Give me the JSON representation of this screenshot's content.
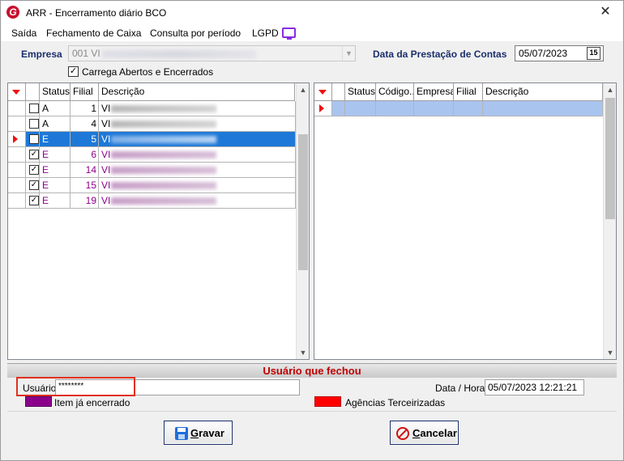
{
  "window": {
    "title": "ARR -  Encerramento diário BCO",
    "close_glyph": "✕",
    "logo_letter": "G"
  },
  "menu": {
    "items": [
      "Saída",
      "Fechamento de Caixa",
      "Consulta por período",
      "LGPD"
    ]
  },
  "header": {
    "empresa_label": "Empresa",
    "empresa_value": "001 VI",
    "data_prestacao_label": "Data da Prestação de Contas",
    "data_prestacao_value": "05/07/2023",
    "calendar_glyph": "15",
    "carrega_label": "Carrega Abertos e Encerrados",
    "carrega_checked": true
  },
  "left_grid": {
    "columns": [
      "Status",
      "Filial",
      "Descrição"
    ],
    "rows": [
      {
        "checked": false,
        "status": "A",
        "filial": "1",
        "descricao": "VI",
        "closed": false,
        "selected": false
      },
      {
        "checked": false,
        "status": "A",
        "filial": "4",
        "descricao": "VI",
        "closed": false,
        "selected": false
      },
      {
        "checked": true,
        "status": "E",
        "filial": "5",
        "descricao": "VI",
        "closed": true,
        "selected": true
      },
      {
        "checked": true,
        "status": "E",
        "filial": "6",
        "descricao": "VI",
        "closed": true,
        "selected": false
      },
      {
        "checked": true,
        "status": "E",
        "filial": "14",
        "descricao": "VI",
        "closed": true,
        "selected": false
      },
      {
        "checked": true,
        "status": "E",
        "filial": "15",
        "descricao": "VI",
        "closed": true,
        "selected": false
      },
      {
        "checked": true,
        "status": "E",
        "filial": "19",
        "descricao": "VI",
        "closed": true,
        "selected": false
      }
    ]
  },
  "right_grid": {
    "columns": [
      "Status",
      "Código...",
      "Empresa",
      "Filial",
      "Descrição"
    ]
  },
  "footer": {
    "usuario_bar_title": "Usuário que fechou",
    "usuario_label": "Usuário",
    "usuario_value": "********",
    "datahora_label": "Data / Hora",
    "datahora_value": "05/07/2023 12:21:21",
    "legend_closed_label": "Item já encerrado",
    "legend_outsourced_label": "Agências Terceirizadas",
    "gravar_label": "Gravar",
    "cancelar_label": "Cancelar"
  },
  "colors": {
    "closed_item": "#8b008b",
    "outsourced_agency": "#ff0000",
    "selection": "#1e78d7",
    "header_label": "#1a2f6b",
    "usuario_bar_title": "#c00000"
  },
  "icons": {
    "lgpd": "monitor-icon",
    "gravar": "floppy-disk-icon",
    "cancelar": "cancel-circle-icon",
    "calendar": "calendar-icon"
  }
}
